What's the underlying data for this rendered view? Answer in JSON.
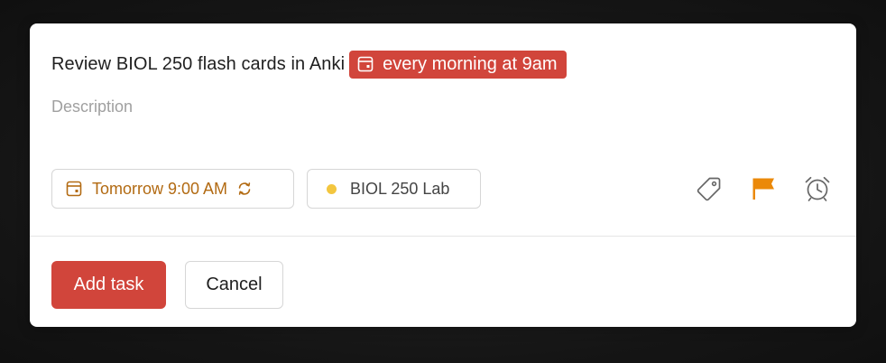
{
  "task": {
    "title": "Review BIOL 250 flash cards in Anki",
    "recurrence_chip": {
      "label": "every morning at 9am",
      "icon": "calendar-icon",
      "color": "#d1453b"
    },
    "description_placeholder": "Description"
  },
  "chips": {
    "due_date": {
      "label": "Tomorrow 9:00 AM",
      "icon": "calendar-icon",
      "repeat_icon": "repeat-icon",
      "color": "#b26a12"
    },
    "project": {
      "label": "BIOL 250 Lab",
      "dot_color": "#f3c63f"
    }
  },
  "actions": [
    {
      "name": "labels",
      "icon": "tag-icon"
    },
    {
      "name": "priority",
      "icon": "flag-icon",
      "color": "#eb8909"
    },
    {
      "name": "reminders",
      "icon": "alarm-clock-icon"
    }
  ],
  "footer": {
    "add_label": "Add task",
    "cancel_label": "Cancel"
  },
  "colors": {
    "accent": "#d1453b",
    "border": "#d6d6d6"
  }
}
